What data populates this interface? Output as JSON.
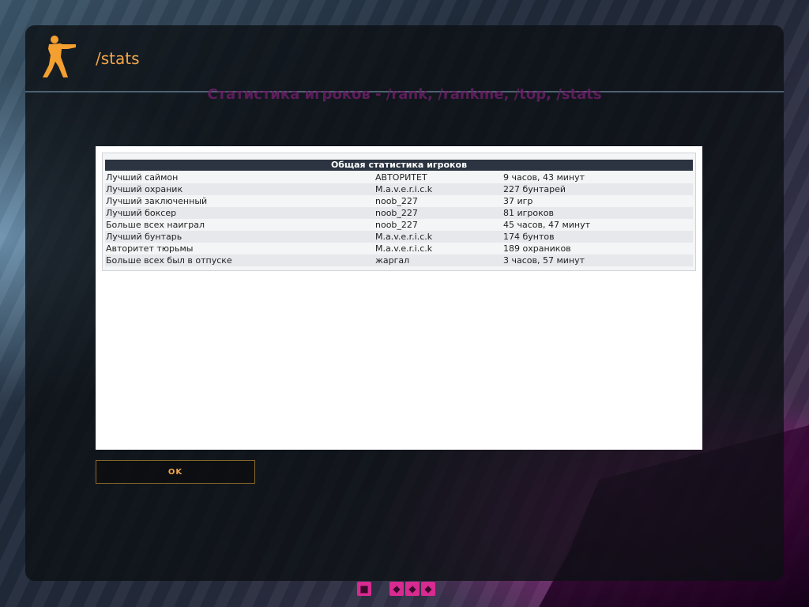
{
  "window": {
    "title": "/stats"
  },
  "background_heading": "Статистика игроков - /rank, /rankme, /top, /stats",
  "stats": {
    "header": "Общая статистика игроков",
    "rows": [
      {
        "category": "Лучший саймон",
        "player": "АВТОРИТЕТ",
        "value": "9 часов, 43 минут"
      },
      {
        "category": "Лучший охраник",
        "player": "M.a.v.e.r.i.c.k",
        "value": "227 бунтарей"
      },
      {
        "category": "Лучший заключенный",
        "player": "noob_227",
        "value": "37 игр"
      },
      {
        "category": "Лучший боксер",
        "player": "noob_227",
        "value": "81 игроков"
      },
      {
        "category": "Больше всех наиграл",
        "player": "noob_227",
        "value": "45 часов, 47 минут"
      },
      {
        "category": "Лучший бунтарь",
        "player": "M.a.v.e.r.i.c.k",
        "value": "174 бунтов"
      },
      {
        "category": "Авторитет тюрьмы",
        "player": "M.a.v.e.r.i.c.k",
        "value": "189 охраников"
      },
      {
        "category": "Больше всех был в отпуске",
        "player": "жаргал",
        "value": "3 часов, 57 минут"
      }
    ]
  },
  "ok_label": "OK",
  "hud": {
    "left_icon": "suit-icon",
    "right_icons": [
      "diamond-icon",
      "diamond-icon",
      "diamond-icon"
    ]
  },
  "colors": {
    "accent": "#f3a64a",
    "heading": "#6a1f66",
    "table_header": "#2b3440"
  }
}
